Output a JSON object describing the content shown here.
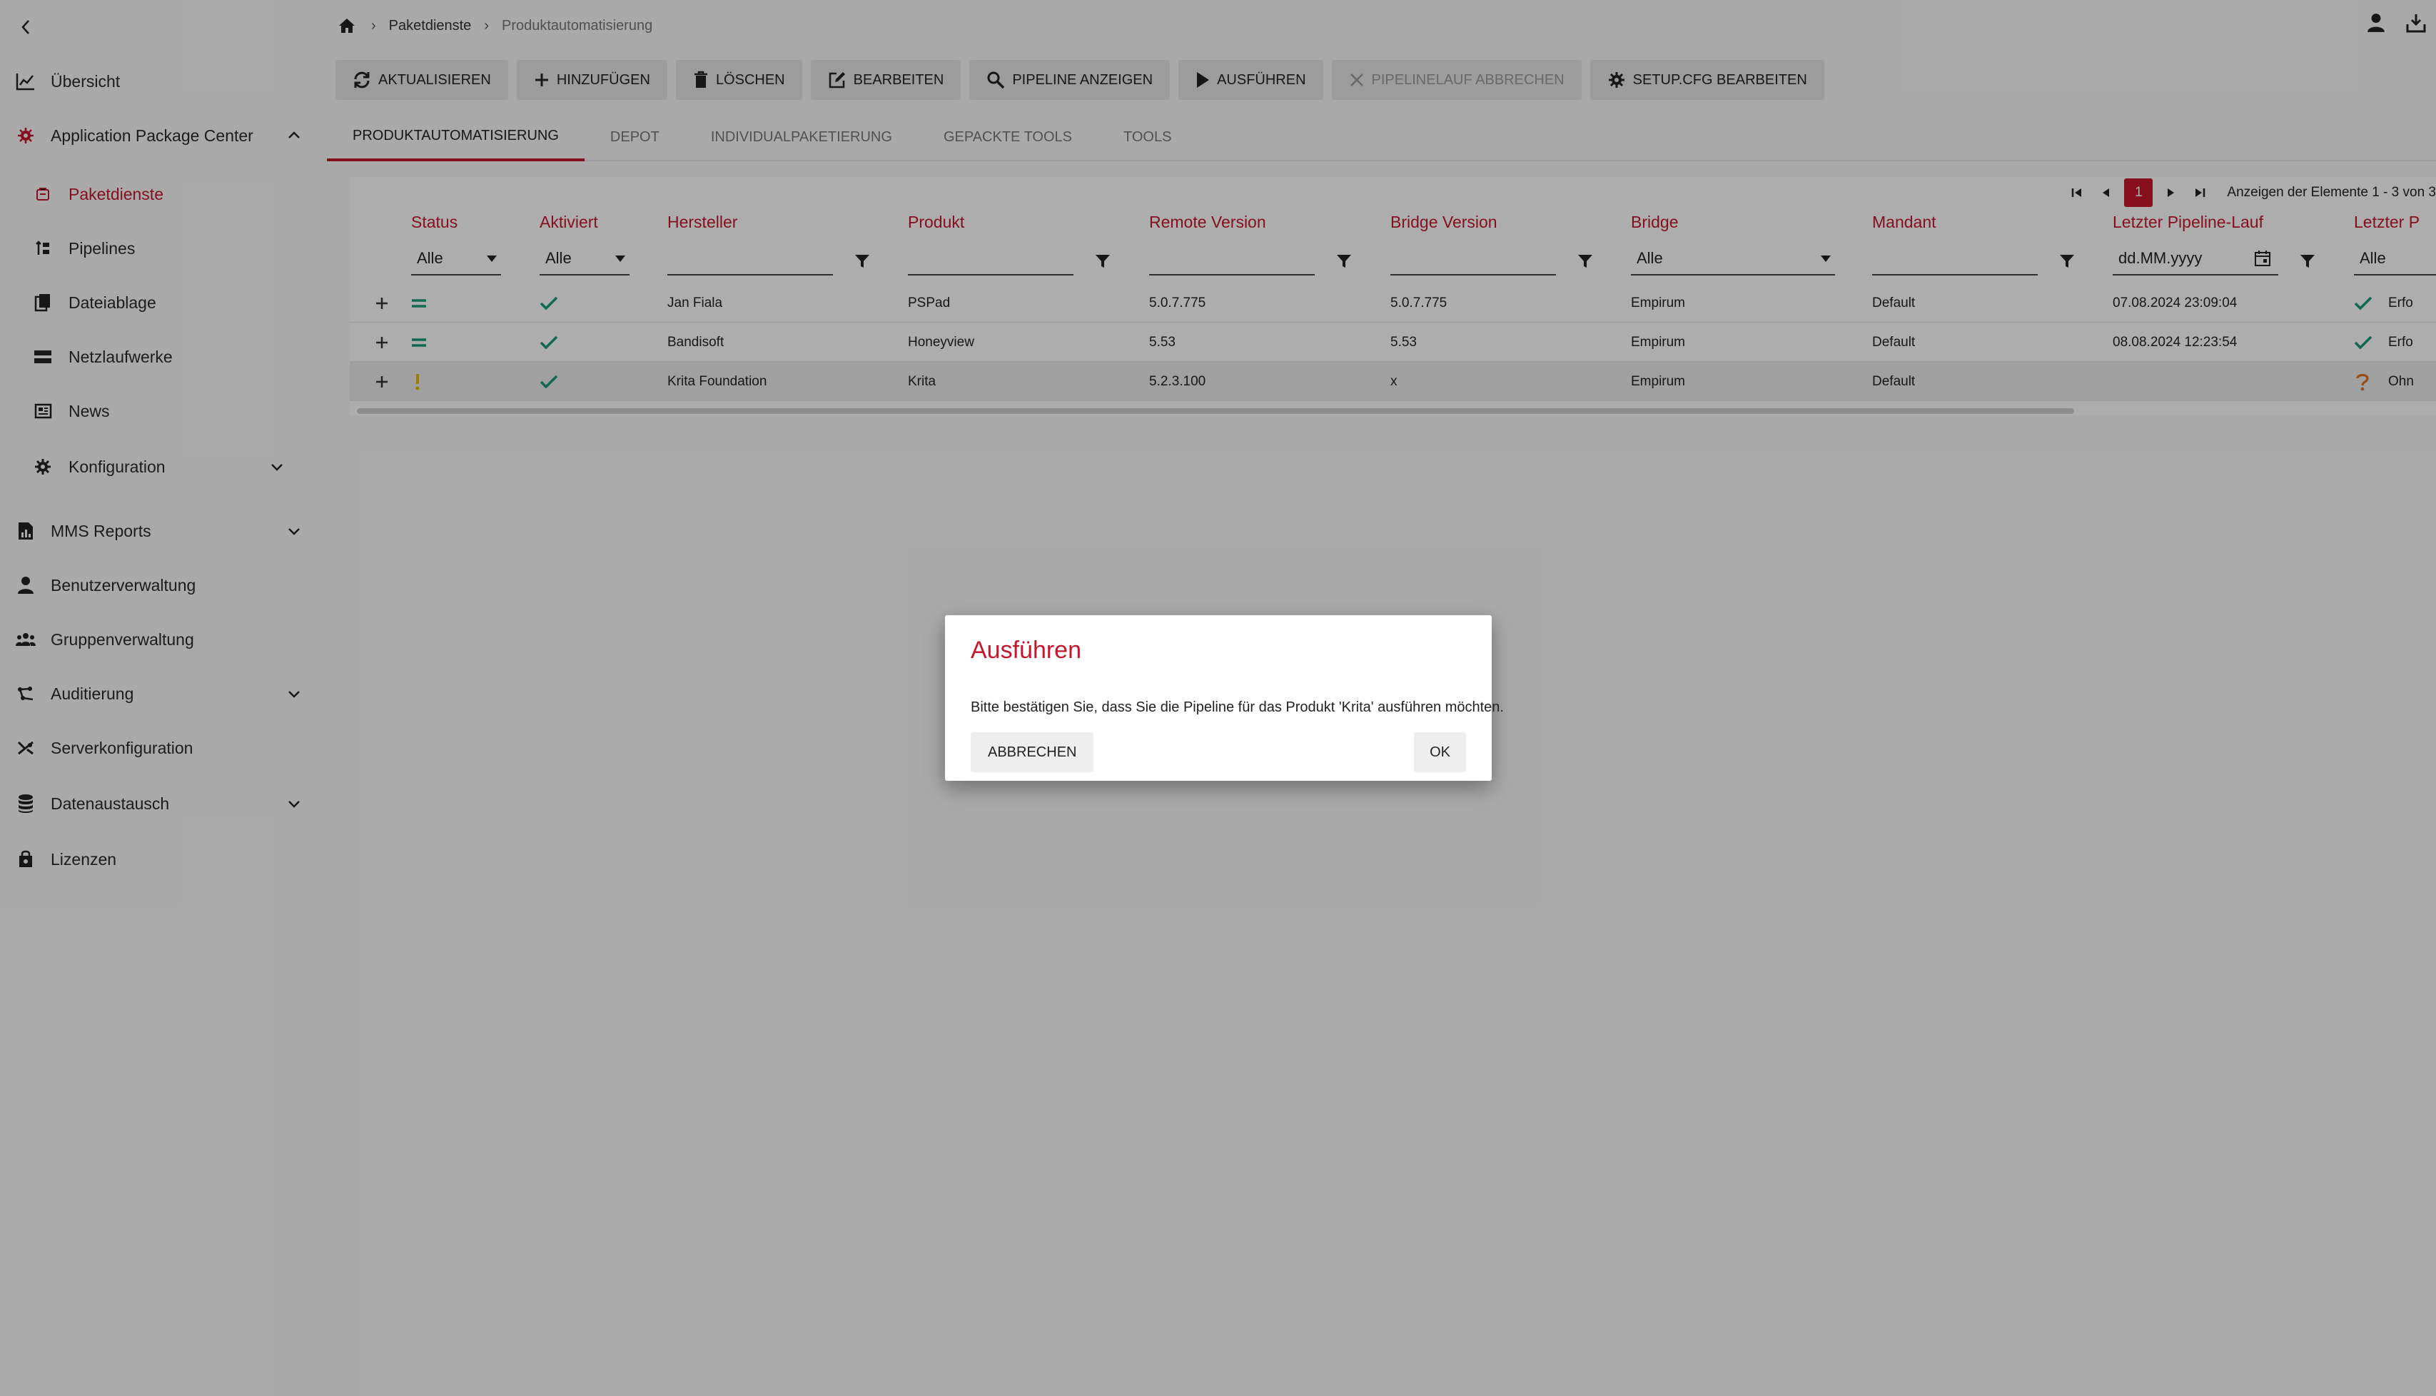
{
  "sidebar": {
    "items": [
      {
        "label": "Übersicht",
        "icon": "chart-line-icon"
      },
      {
        "label": "Application Package Center",
        "icon": "package-icon"
      },
      {
        "label": "Paketdienste",
        "icon": "package-service-icon"
      },
      {
        "label": "Pipelines",
        "icon": "pipeline-icon"
      },
      {
        "label": "Dateiablage",
        "icon": "files-icon"
      },
      {
        "label": "Netzlaufwerke",
        "icon": "network-drive-icon"
      },
      {
        "label": "News",
        "icon": "news-icon"
      },
      {
        "label": "Konfiguration",
        "icon": "gear-icon"
      },
      {
        "label": "MMS Reports",
        "icon": "report-icon"
      },
      {
        "label": "Benutzerverwaltung",
        "icon": "user-icon"
      },
      {
        "label": "Gruppenverwaltung",
        "icon": "group-icon"
      },
      {
        "label": "Auditierung",
        "icon": "audit-icon"
      },
      {
        "label": "Serverkonfiguration",
        "icon": "server-config-icon"
      },
      {
        "label": "Datenaustausch",
        "icon": "database-icon"
      },
      {
        "label": "Lizenzen",
        "icon": "license-icon"
      }
    ]
  },
  "breadcrumb": {
    "home": "home-icon",
    "level1": "Paketdienste",
    "current": "Produktautomatisierung"
  },
  "toolbar": {
    "refresh": "AKTUALISIEREN",
    "add": "HINZUFÜGEN",
    "delete": "LÖSCHEN",
    "edit": "BEARBEITEN",
    "show_pipeline": "PIPELINE ANZEIGEN",
    "run": "AUSFÜHREN",
    "cancel_run": "PIPELINELAUF ABBRECHEN",
    "edit_setup": "SETUP.CFG BEARBEITEN"
  },
  "tabs": [
    {
      "label": "PRODUKTAUTOMATISIERUNG"
    },
    {
      "label": "DEPOT"
    },
    {
      "label": "INDIVIDUALPAKETIERUNG"
    },
    {
      "label": "GEPACKTE TOOLS"
    },
    {
      "label": "TOOLS"
    }
  ],
  "pager": {
    "page": "1",
    "info": "Anzeigen der Elemente 1 - 3 von 3"
  },
  "grid": {
    "columns": {
      "status": "Status",
      "aktiviert": "Aktiviert",
      "hersteller": "Hersteller",
      "produkt": "Produkt",
      "remote_version": "Remote Version",
      "bridge_version": "Bridge Version",
      "bridge": "Bridge",
      "mandant": "Mandant",
      "letzter_lauf": "Letzter Pipeline-Lauf",
      "letzter_status": "Letzter P"
    },
    "filters": {
      "status": "Alle",
      "aktiviert": "Alle",
      "bridge": "Alle",
      "date_placeholder": "dd.MM.yyyy",
      "letzter_status": "Alle"
    },
    "rows": [
      {
        "status": "equal",
        "hersteller": "Jan Fiala",
        "produkt": "PSPad",
        "remote_version": "5.0.7.775",
        "bridge_version": "5.0.7.775",
        "bridge": "Empirum",
        "mandant": "Default",
        "letzter_lauf": "07.08.2024 23:09:04",
        "letzter_status": "Erfo"
      },
      {
        "status": "equal",
        "hersteller": "Bandisoft",
        "produkt": "Honeyview",
        "remote_version": "5.53",
        "bridge_version": "5.53",
        "bridge": "Empirum",
        "mandant": "Default",
        "letzter_lauf": "08.08.2024 12:23:54",
        "letzter_status": "Erfo"
      },
      {
        "status": "warning",
        "hersteller": "Krita Foundation",
        "produkt": "Krita",
        "remote_version": "5.2.3.100",
        "bridge_version": "x",
        "bridge": "Empirum",
        "mandant": "Default",
        "letzter_lauf": "",
        "letzter_status": "Ohn"
      }
    ]
  },
  "dialog": {
    "title": "Ausführen",
    "message": "Bitte bestätigen Sie, dass Sie die Pipeline für das Produkt 'Krita' ausführen möchten.",
    "cancel": "ABBRECHEN",
    "ok": "OK"
  },
  "colors": {
    "accent": "#c4172c",
    "success": "#1a9a7a",
    "warning": "#e6b800",
    "unknown": "#e07020"
  }
}
